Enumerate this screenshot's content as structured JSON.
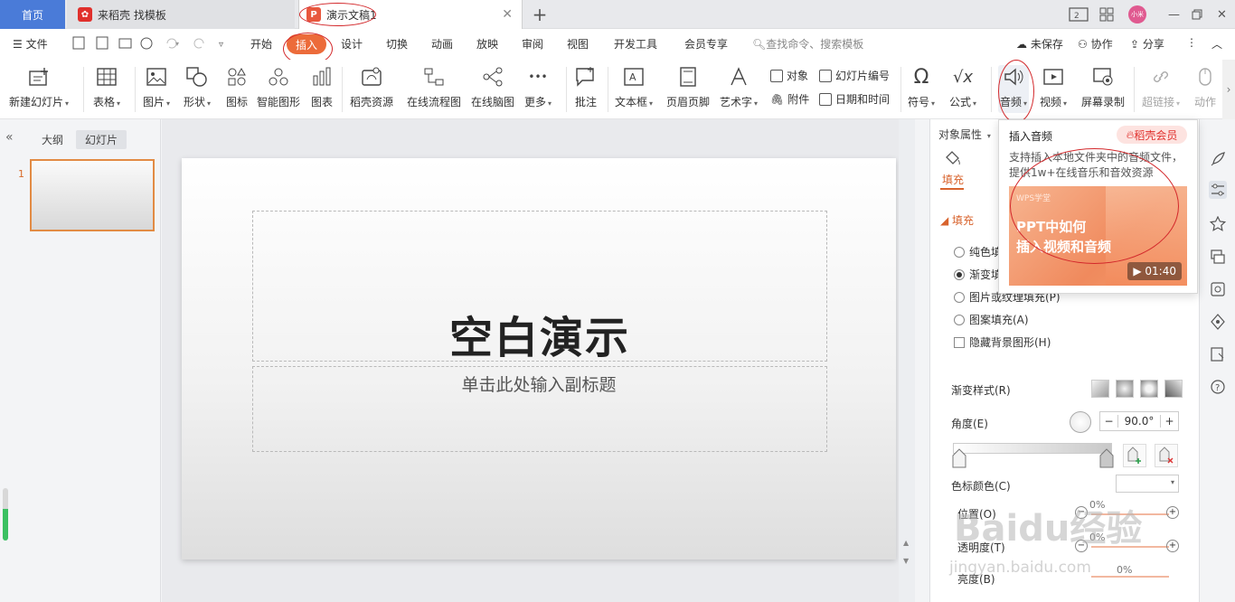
{
  "tabs": {
    "home": "首页",
    "daoke": "来稻壳 找模板",
    "doc": "演示文稿1",
    "add": "+"
  },
  "window": {
    "avatar": "小米"
  },
  "menu": {
    "file": "文件",
    "items": [
      "开始",
      "插入",
      "设计",
      "切换",
      "动画",
      "放映",
      "审阅",
      "视图",
      "开发工具",
      "会员专享"
    ],
    "search_placeholder": "查找命令、搜索模板",
    "unsaved": "未保存",
    "collab": "协作",
    "share": "分享"
  },
  "ribbon": {
    "new_slide": "新建幻灯片",
    "table": "表格",
    "picture": "图片",
    "shape": "形状",
    "icon": "图标",
    "smart_shape": "智能图形",
    "chart": "图表",
    "daoke_res": "稻壳资源",
    "flowchart": "在线流程图",
    "mindmap": "在线脑图",
    "more": "更多",
    "comment": "批注",
    "textbox": "文本框",
    "header_footer": "页眉页脚",
    "art_text": "艺术字",
    "object": "对象",
    "attachment": "附件",
    "slide_number": "幻灯片编号",
    "datetime": "日期和时间",
    "symbol": "符号",
    "formula": "公式",
    "audio": "音频",
    "video": "视频",
    "screen_record": "屏幕录制",
    "hyperlink": "超链接",
    "action": "动作"
  },
  "left_pane": {
    "outline": "大纲",
    "slides": "幻灯片",
    "slide_number": "1"
  },
  "slide": {
    "title": "空白演示",
    "subtitle": "单击此处输入副标题"
  },
  "panel": {
    "header": "对象属性",
    "fill_tab": "填充",
    "fill_section": "填充",
    "options": [
      "纯色填充(S)",
      "渐变填充(G)",
      "图片或纹理填充(P)",
      "图案填充(A)"
    ],
    "selected_option": "渐变填充(G)",
    "hide_bg": "隐藏背景图形(H)",
    "gradient_style": "渐变样式(R)",
    "angle": "角度(E)",
    "angle_value": "90.0°",
    "stop_color": "色标颜色(C)",
    "position": "位置(O)",
    "position_value": "0%",
    "transparency": "透明度(T)",
    "transparency_value": "0%",
    "brightness": "亮度(B)",
    "brightness_value": "0%"
  },
  "popup": {
    "title": "插入音频",
    "badge": "稻壳会员",
    "description": "支持插入本地文件夹中的音频文件，提供1w+在线音乐和音效资源",
    "video_brand": "WPS学堂",
    "video_title_1": "PPT中如何",
    "video_title_2": "插入视频和音频",
    "video_duration": "01:40"
  },
  "watermark": {
    "brand": "Baidu经验",
    "url": "jingyan.baidu.com"
  },
  "colors": {
    "accent": "#ec6b3a",
    "home_tab": "#4a7bd8",
    "annotation_red": "#d3282b"
  }
}
